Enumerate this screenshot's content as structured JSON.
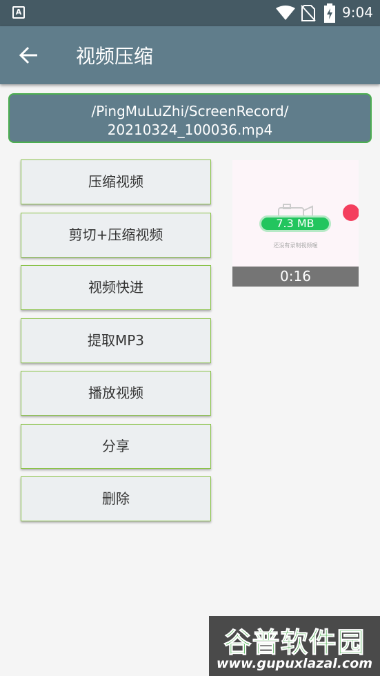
{
  "status_bar": {
    "time": "9:04",
    "icons": [
      "app-a-icon",
      "wifi-icon",
      "no-sim-icon",
      "battery-charging-icon"
    ]
  },
  "app_bar": {
    "title": "视频压缩",
    "back_icon": "arrow-left-icon"
  },
  "file": {
    "path_line1": "/PingMuLuZhi/ScreenRecord/",
    "path_line2": "20210324_100036.mp4"
  },
  "actions": [
    {
      "label": "压缩视频"
    },
    {
      "label": "剪切+压缩视频"
    },
    {
      "label": "视频快进"
    },
    {
      "label": "提取MP3"
    },
    {
      "label": "播放视频"
    },
    {
      "label": "分享"
    },
    {
      "label": "删除"
    }
  ],
  "thumbnail": {
    "size": "7.3 MB",
    "hint": "还没有录制视频喔",
    "duration": "0:16"
  },
  "watermark": {
    "title": "谷普软件园",
    "url": "www.gupuxlazal.com"
  },
  "colors": {
    "status_bar": "#455a64",
    "app_bar": "#607d8b",
    "accent_green": "#4caf50",
    "button_bg": "#eceff1"
  }
}
